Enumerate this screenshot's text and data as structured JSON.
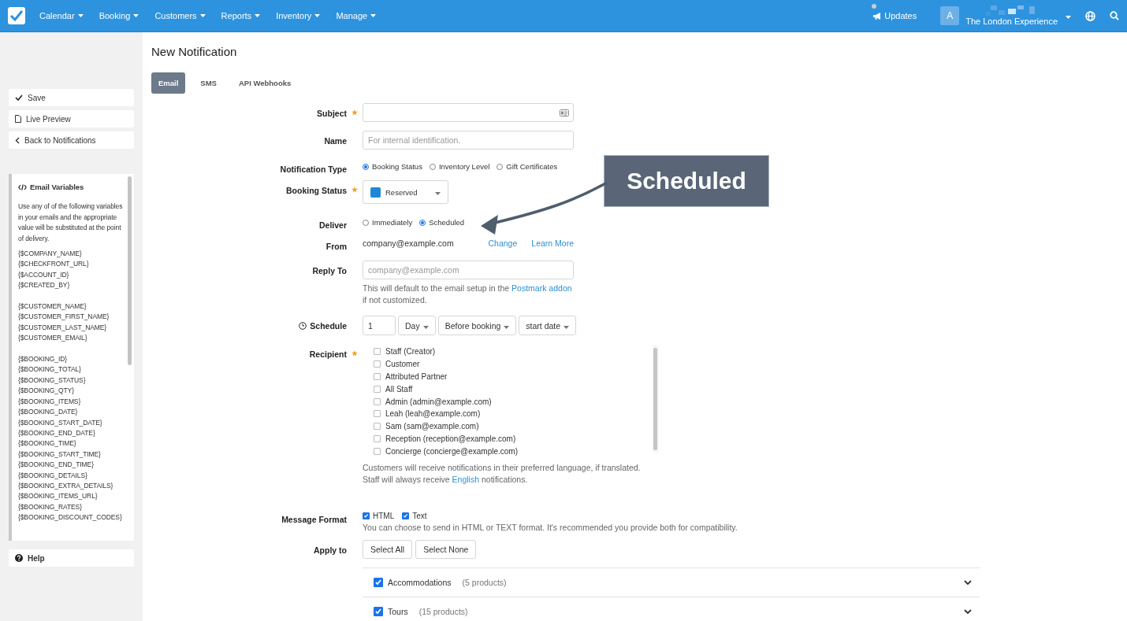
{
  "nav": {
    "menus": [
      "Calendar",
      "Booking",
      "Customers",
      "Reports",
      "Inventory",
      "Manage"
    ],
    "updates": "Updates",
    "avatar": "A",
    "account": "The London Experience"
  },
  "sidebar": {
    "actions": [
      {
        "kind": "save",
        "label": "Save"
      },
      {
        "kind": "preview",
        "label": "Live Preview"
      },
      {
        "kind": "back",
        "label": "Back to Notifications"
      }
    ],
    "variables": {
      "title": "Email Variables",
      "description": "Use any of of the following variables in your emails and the appropriate value will be substituted at the point of delivery.",
      "groups": [
        [
          "{$COMPANY_NAME}",
          "{$CHECKFRONT_URL}",
          "{$ACCOUNT_ID}",
          "{$CREATED_BY}"
        ],
        [
          "{$CUSTOMER_NAME}",
          "{$CUSTOMER_FIRST_NAME}",
          "{$CUSTOMER_LAST_NAME}",
          "{$CUSTOMER_EMAIL}"
        ],
        [
          "{$BOOKING_ID}",
          "{$BOOKING_TOTAL}",
          "{$BOOKING_STATUS}",
          "{$BOOKING_QTY}",
          "{$BOOKING_ITEMS}",
          "{$BOOKING_DATE}",
          "{$BOOKING_START_DATE}",
          "{$BOOKING_END_DATE}",
          "{$BOOKING_TIME}",
          "{$BOOKING_START_TIME}",
          "{$BOOKING_END_TIME}",
          "{$BOOKING_DETAILS}",
          "{$BOOKING_EXTRA_DETAILS}",
          "{$BOOKING_ITEMS_URL}",
          "{$BOOKING_RATES}",
          "{$BOOKING_DISCOUNT_CODES}"
        ]
      ]
    },
    "help": "Help"
  },
  "page": {
    "title": "New Notification",
    "tabs": [
      {
        "label": "Email",
        "selected": true
      },
      {
        "label": "SMS",
        "selected": false
      },
      {
        "label": "API Webhooks",
        "selected": false
      }
    ]
  },
  "form": [
    {
      "kind": "template_input",
      "label": "Subject",
      "required": true
    },
    {
      "kind": "input",
      "label": "Name",
      "required": false,
      "placeholder": "For internal identification."
    },
    {
      "kind": "radios",
      "label": "Notification Type",
      "required": false,
      "options": [
        {
          "label": "Booking Status",
          "selected": true
        },
        {
          "label": "Inventory Level",
          "selected": false
        },
        {
          "label": "Gift Certificates",
          "selected": false
        }
      ]
    },
    {
      "kind": "status_select",
      "label": "Booking Status",
      "required": true,
      "value": "Reserved"
    },
    {
      "kind": "radios",
      "label": "Deliver",
      "required": false,
      "options": [
        {
          "label": "Immediately",
          "selected": false
        },
        {
          "label": "Scheduled",
          "selected": true
        }
      ]
    },
    {
      "kind": "from",
      "label": "From",
      "required": false,
      "value": "company@example.com",
      "links": [
        "Change",
        "Learn More"
      ]
    },
    {
      "kind": "input",
      "label": "Reply To",
      "required": false,
      "placeholder": "company@example.com",
      "help": "This will default to the email setup in the",
      "help_link": "Postmark addon",
      "help_after": "if not customized."
    },
    {
      "kind": "schedule",
      "label": "Schedule",
      "required": false,
      "amount": "1",
      "selects": [
        "Day",
        "Before booking",
        "start date"
      ]
    },
    {
      "kind": "checklist",
      "label": "Recipient",
      "required": true,
      "options": [
        {
          "label": "Staff (Creator)",
          "checked": false
        },
        {
          "label": "Customer",
          "checked": false
        },
        {
          "label": "Attributed Partner",
          "checked": false
        },
        {
          "label": "All Staff",
          "checked": false
        },
        {
          "label": "Admin (admin@example.com)",
          "checked": false
        },
        {
          "label": "Leah (leah@example.com)",
          "checked": false
        },
        {
          "label": "Sam (sam@example.com)",
          "checked": false
        },
        {
          "label": "Reception (reception@example.com)",
          "checked": false
        },
        {
          "label": "Concierge (concierge@example.com)",
          "checked": false
        }
      ],
      "note": "Customers will receive notifications in their preferred language, if translated.",
      "note2": "Staff will always receive",
      "note2_link": "English",
      "note2_after": "notifications."
    },
    {
      "kind": "format",
      "label": "Message Format",
      "required": false,
      "options": [
        {
          "label": "HTML",
          "checked": true
        },
        {
          "label": "Text",
          "checked": true
        }
      ],
      "help": "You can choose to send in HTML or TEXT format. It's recommended you provide both for compatibility."
    },
    {
      "kind": "apply",
      "label": "Apply to",
      "required": false,
      "buttons": [
        "Select All",
        "Select None"
      ],
      "categories": [
        {
          "name": "Accommodations",
          "count": "(5 products)",
          "checked": true
        },
        {
          "name": "Tours",
          "count": "(15 products)",
          "checked": true
        }
      ]
    }
  ],
  "callout": {
    "text": "Scheduled"
  }
}
